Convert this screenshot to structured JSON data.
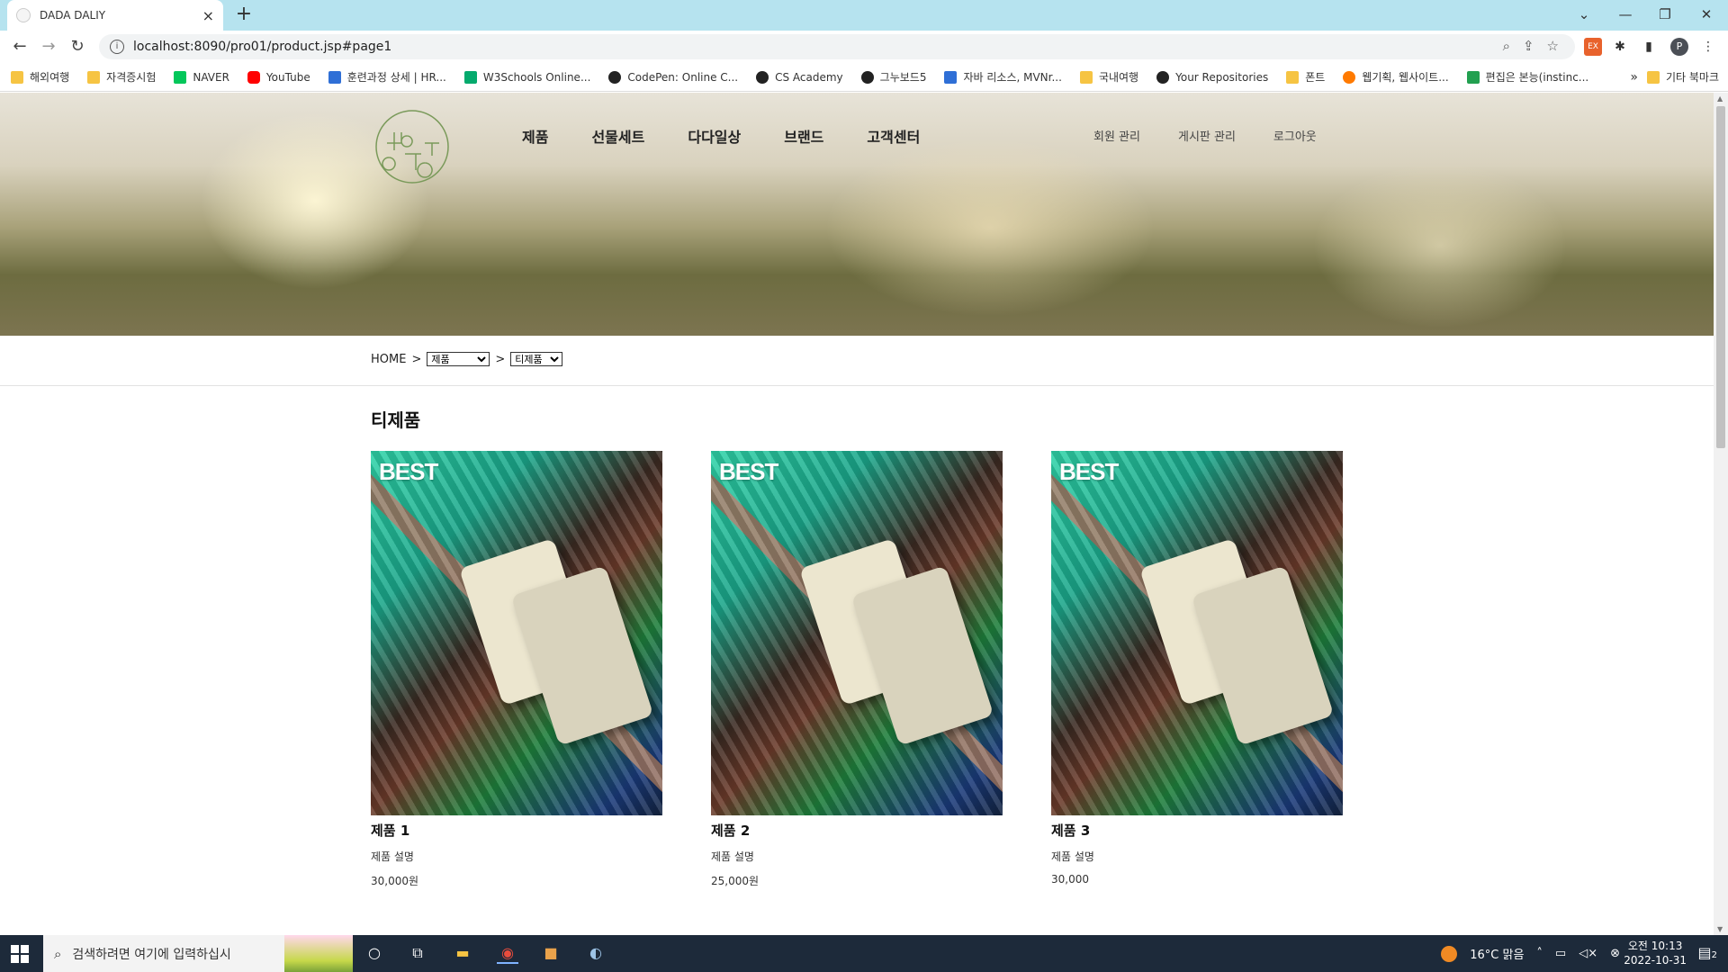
{
  "browser": {
    "tab_title": "DADA DALIY",
    "tab_close": "×",
    "new_tab": "+",
    "url": "localhost:8090/pro01/product.jsp#page1",
    "profile_initial": "P",
    "window_controls": {
      "dropdown": "⌄",
      "minimize": "—",
      "restore": "❐",
      "close": "✕"
    }
  },
  "bookmarks": [
    {
      "label": "해외여행",
      "icon": "folder"
    },
    {
      "label": "자격증시험",
      "icon": "folder"
    },
    {
      "label": "NAVER",
      "icon": "naver"
    },
    {
      "label": "YouTube",
      "icon": "yt"
    },
    {
      "label": "훈련과정 상세 | HR...",
      "icon": "blue"
    },
    {
      "label": "W3Schools Online...",
      "icon": "w3"
    },
    {
      "label": "CodePen: Online C...",
      "icon": "dark"
    },
    {
      "label": "CS Academy",
      "icon": "dark"
    },
    {
      "label": "그누보드5",
      "icon": "dark"
    },
    {
      "label": "자바 리소스, MVNr...",
      "icon": "blue"
    },
    {
      "label": "국내여행",
      "icon": "folder"
    },
    {
      "label": "Your Repositories",
      "icon": "dark"
    },
    {
      "label": "폰트",
      "icon": "folder"
    },
    {
      "label": "웹기획, 웹사이트...",
      "icon": "org"
    },
    {
      "label": "편집은 본능(instinc...",
      "icon": "green"
    }
  ],
  "bookmarks_more": "»",
  "bookmarks_other": "기타 북마크",
  "site": {
    "logo_text": "다다일상",
    "nav": [
      "제품",
      "선물세트",
      "다다일상",
      "브랜드",
      "고객센터"
    ],
    "subnav": [
      "회원 관리",
      "게시판 관리",
      "로그아웃"
    ],
    "breadcrumb": {
      "home": "HOME",
      "sep": ">",
      "select1": "제품",
      "select2": "티제품"
    },
    "category_title": "티제품",
    "products": [
      {
        "badge": "BEST",
        "name": "제품 1",
        "desc": "제품 설명",
        "price": "30,000원"
      },
      {
        "badge": "BEST",
        "name": "제품 2",
        "desc": "제품 설명",
        "price": "25,000원"
      },
      {
        "badge": "BEST",
        "name": "제품 3",
        "desc": "제품 설명",
        "price": "30,000"
      }
    ]
  },
  "taskbar": {
    "search_placeholder": "검색하려면 여기에 입력하십시",
    "weather": "16°C  맑음",
    "time": "오전 10:13",
    "date": "2022-10-31",
    "notification_count": "2"
  }
}
